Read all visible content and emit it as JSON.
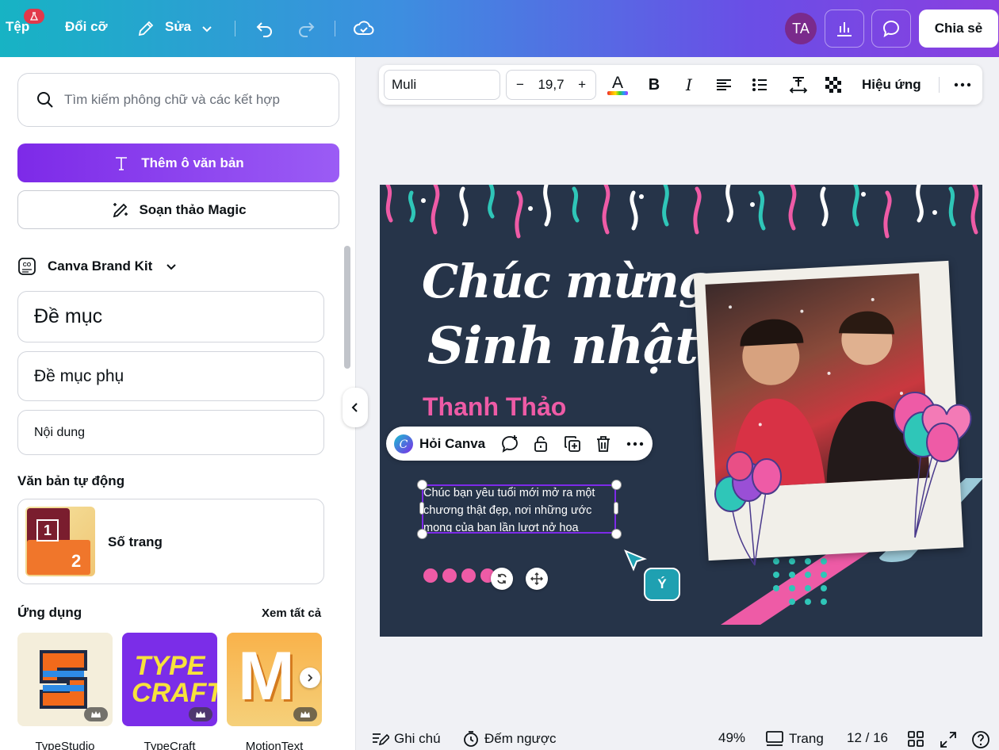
{
  "topbar": {
    "file": "Tệp",
    "resize": "Đổi cỡ",
    "edit": "Sửa",
    "avatar_initials": "TA",
    "share": "Chia sẻ"
  },
  "sidebar": {
    "search_placeholder": "Tìm kiếm phông chữ và các kết hợp",
    "add_textbox": "Thêm ô văn bản",
    "magic_write": "Soạn thảo Magic",
    "brand_kit": "Canva Brand Kit",
    "heading": "Đề mục",
    "subheading": "Đề mục phụ",
    "body": "Nội dung",
    "auto_text_title": "Văn bản tự động",
    "page_number_label": "Số trang",
    "page_thumb_1": "1",
    "page_thumb_2": "2",
    "apps_title": "Ứng dụng",
    "see_all": "Xem tất cả",
    "apps": [
      {
        "name": "TypeStudio"
      },
      {
        "name": "TypeCraft",
        "logo": "TYPE CRAFT"
      },
      {
        "name": "MotionText",
        "logo": "M"
      }
    ]
  },
  "format_toolbar": {
    "font": "Muli",
    "size_minus": "−",
    "size": "19,7",
    "size_plus": "+",
    "color_glyph": "A",
    "bold_glyph": "B",
    "italic_glyph": "I",
    "effects": "Hiệu ứng"
  },
  "canvas": {
    "title_line1": "Chúc mừng",
    "title_line2": "Sinh nhật",
    "name": "Thanh Thảo",
    "body": "Chúc bạn yêu tuổi mới mở ra một chương thật đẹp, nơi những ước mong của bạn lần lượt nở hoa"
  },
  "context_toolbar": {
    "ask_canva": "Hỏi Canva"
  },
  "collaborator_cursor": {
    "label": "Ý"
  },
  "bottombar": {
    "notes": "Ghi chú",
    "timer": "Đếm ngược",
    "zoom": "49%",
    "pages": "Trang",
    "page_counter": "12 / 16"
  },
  "colors": {
    "accent_purple": "#7d2ae8",
    "canvas_bg": "#263449",
    "pink": "#ee5ba6",
    "teal": "#2fc6b8"
  }
}
